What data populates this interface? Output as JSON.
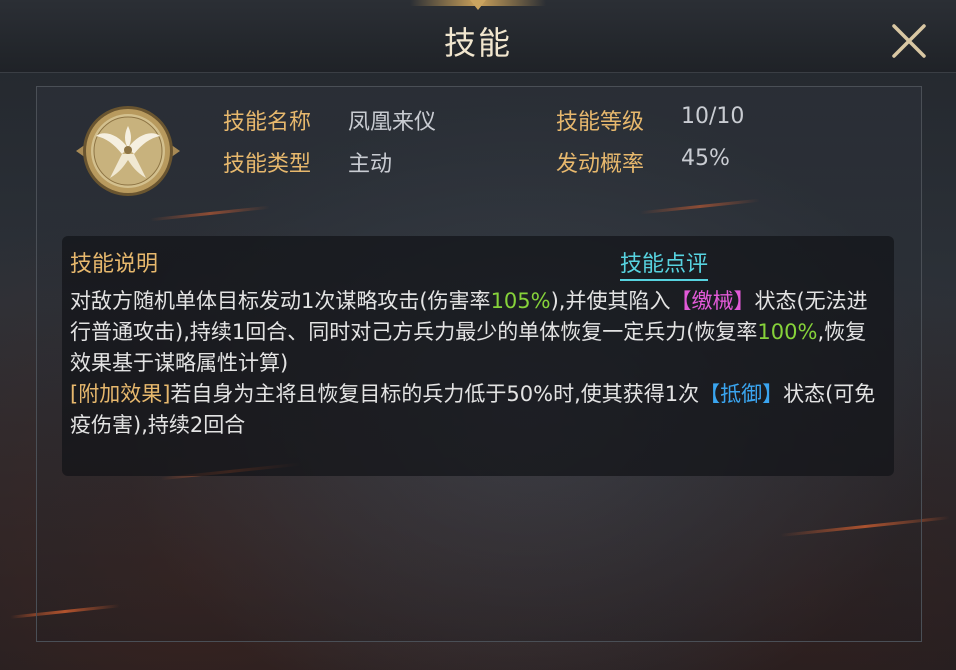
{
  "window": {
    "title": "技能"
  },
  "skill": {
    "icon": "phoenix-emblem-icon",
    "name_label": "技能名称",
    "name": "凤凰来仪",
    "type_label": "技能类型",
    "type": "主动",
    "level_label": "技能等级",
    "level": "10/10",
    "chance_label": "发动概率",
    "chance": "45%"
  },
  "description": {
    "title": "技能说明",
    "review_link": "技能点评",
    "seg1": "对敌方随机单体目标发动1次谋略攻击(伤害率",
    "rate1": "105%",
    "seg2": "),并使其陷入",
    "tag1": "【缴械】",
    "seg3": "状态(无法进行普通攻击),持续1回合、同时对己方兵力最少的单体恢复一定兵力(恢复率",
    "rate2": "100%",
    "seg4": ",恢复效果基于谋略属性计算)",
    "extra_tag": "[附加效果]",
    "seg5": "若自身为主将且恢复目标的兵力低于50%时,使其获得1次",
    "tag2": "【抵御】",
    "seg6": "状态(可免疫伤害),持续2回合"
  },
  "colors": {
    "label_gold": "#e7b86d",
    "link_cyan": "#57d3e0",
    "rate_green": "#86d23a",
    "tag_pink": "#e25ad8",
    "tag_blue": "#3aa5f0"
  }
}
